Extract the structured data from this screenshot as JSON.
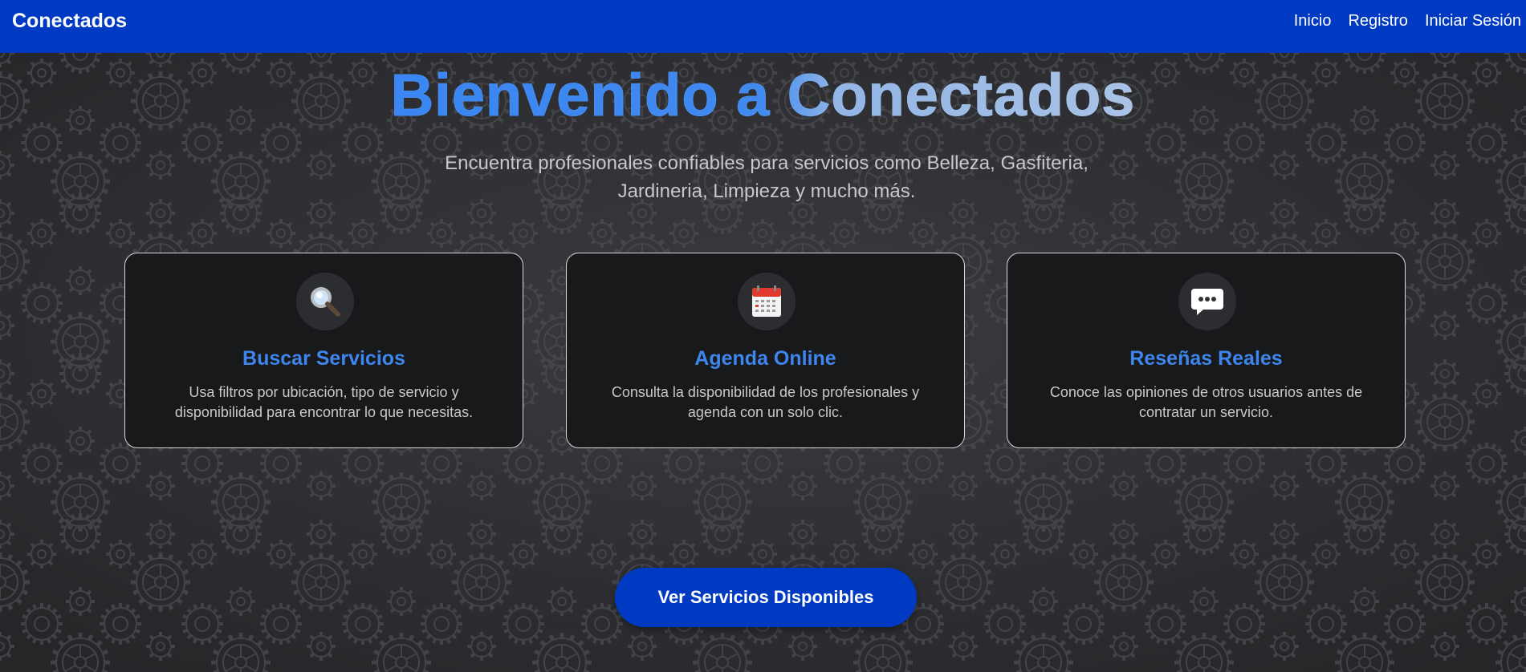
{
  "navbar": {
    "brand": "Conectados",
    "links": [
      "Inicio",
      "Registro",
      "Iniciar Sesión"
    ]
  },
  "hero": {
    "title": "Bienvenido a Conectados",
    "subtitle": "Encuentra profesionales confiables para servicios como Belleza, Gasfiteria, Jardineria, Limpieza y mucho más."
  },
  "features": [
    {
      "icon": "magnifying-glass-icon",
      "title": "Buscar Servicios",
      "description": "Usa filtros por ubicación, tipo de servicio y disponibilidad para encontrar lo que necesitas."
    },
    {
      "icon": "calendar-icon",
      "title": "Agenda Online",
      "description": "Consulta la disponibilidad de los profesionales y agenda con un solo clic."
    },
    {
      "icon": "speech-bubble-icon",
      "title": "Reseñas Reales",
      "description": "Conoce las opiniones de otros usuarios antes de contratar un servicio."
    }
  ],
  "cta": {
    "label": "Ver Servicios Disponibles"
  },
  "colors": {
    "primary": "#0039c2",
    "accent": "#3e86ed",
    "background": "#2b2c30",
    "card": "#18191b"
  }
}
